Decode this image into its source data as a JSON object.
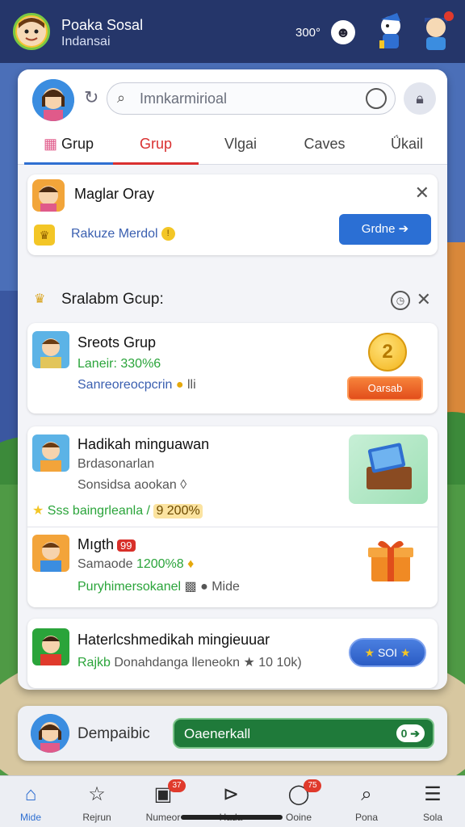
{
  "topbar": {
    "name": "Poaka Sosal",
    "subtitle": "Indansai",
    "count": "300°",
    "coin_icon": "face-coin-icon"
  },
  "search": {
    "placeholder": "Imnkarmirioal"
  },
  "tabs": [
    {
      "label": "Grup"
    },
    {
      "label": "Grup"
    },
    {
      "label": "Vlgai"
    },
    {
      "label": "Caves"
    },
    {
      "label": "Ǘkail"
    }
  ],
  "notice_card": {
    "title": "Maglar Oray",
    "subtitle": "Rakuze Merdol",
    "button_label": "Grdne ➔"
  },
  "section": {
    "title": "Sralabm Gcup:"
  },
  "group_card": {
    "title": "Sreots Grup",
    "line1": "Laneir: 330%6",
    "line2": "Sanreoreocpcrin",
    "line2_suffix": "lli",
    "coin_value": "2",
    "button_label": "Oarsab"
  },
  "list_card": {
    "item1": {
      "title": "Hadikah minguawan",
      "line1": "Brdasonarlan",
      "line2": "Sonsidsa aookan",
      "line3_left": "Sss baingrleanla /",
      "line3_pill": "9 200%"
    },
    "item2": {
      "title": "Mıgth",
      "hearts": "99",
      "line1_prefix": "Samaode",
      "line1_num": "1200%8",
      "line2": "Puryhimersokanel",
      "line2_suffix": "Mide"
    }
  },
  "promo_card": {
    "title": "Haterlcshmedikah mingieuuar",
    "line_green": "Rajkb",
    "line_rest": "Donahdanga lleneokn ★ 10 10k)",
    "button_label": "SOI"
  },
  "bottom_card": {
    "label": "Dempaibic",
    "bar_label": "Oaenerkall",
    "bar_value": "0"
  },
  "bottom_nav": [
    {
      "label": "Mide",
      "icon": "home-icon",
      "badge": ""
    },
    {
      "label": "Rejrun",
      "icon": "star-icon",
      "badge": ""
    },
    {
      "label": "Numeor",
      "icon": "box-icon",
      "badge": "37"
    },
    {
      "label": "Hada",
      "icon": "play-icon",
      "badge": ""
    },
    {
      "label": "Ooine",
      "icon": "chat-icon",
      "badge": "75"
    },
    {
      "label": "Pona",
      "icon": "search-icon",
      "badge": ""
    },
    {
      "label": "Sola",
      "icon": "menu-icon",
      "badge": ""
    }
  ],
  "colors": {
    "accent_blue": "#2f6fd1",
    "accent_red": "#d93030",
    "accent_green": "#2aa43a",
    "topbar": "#25366a"
  }
}
